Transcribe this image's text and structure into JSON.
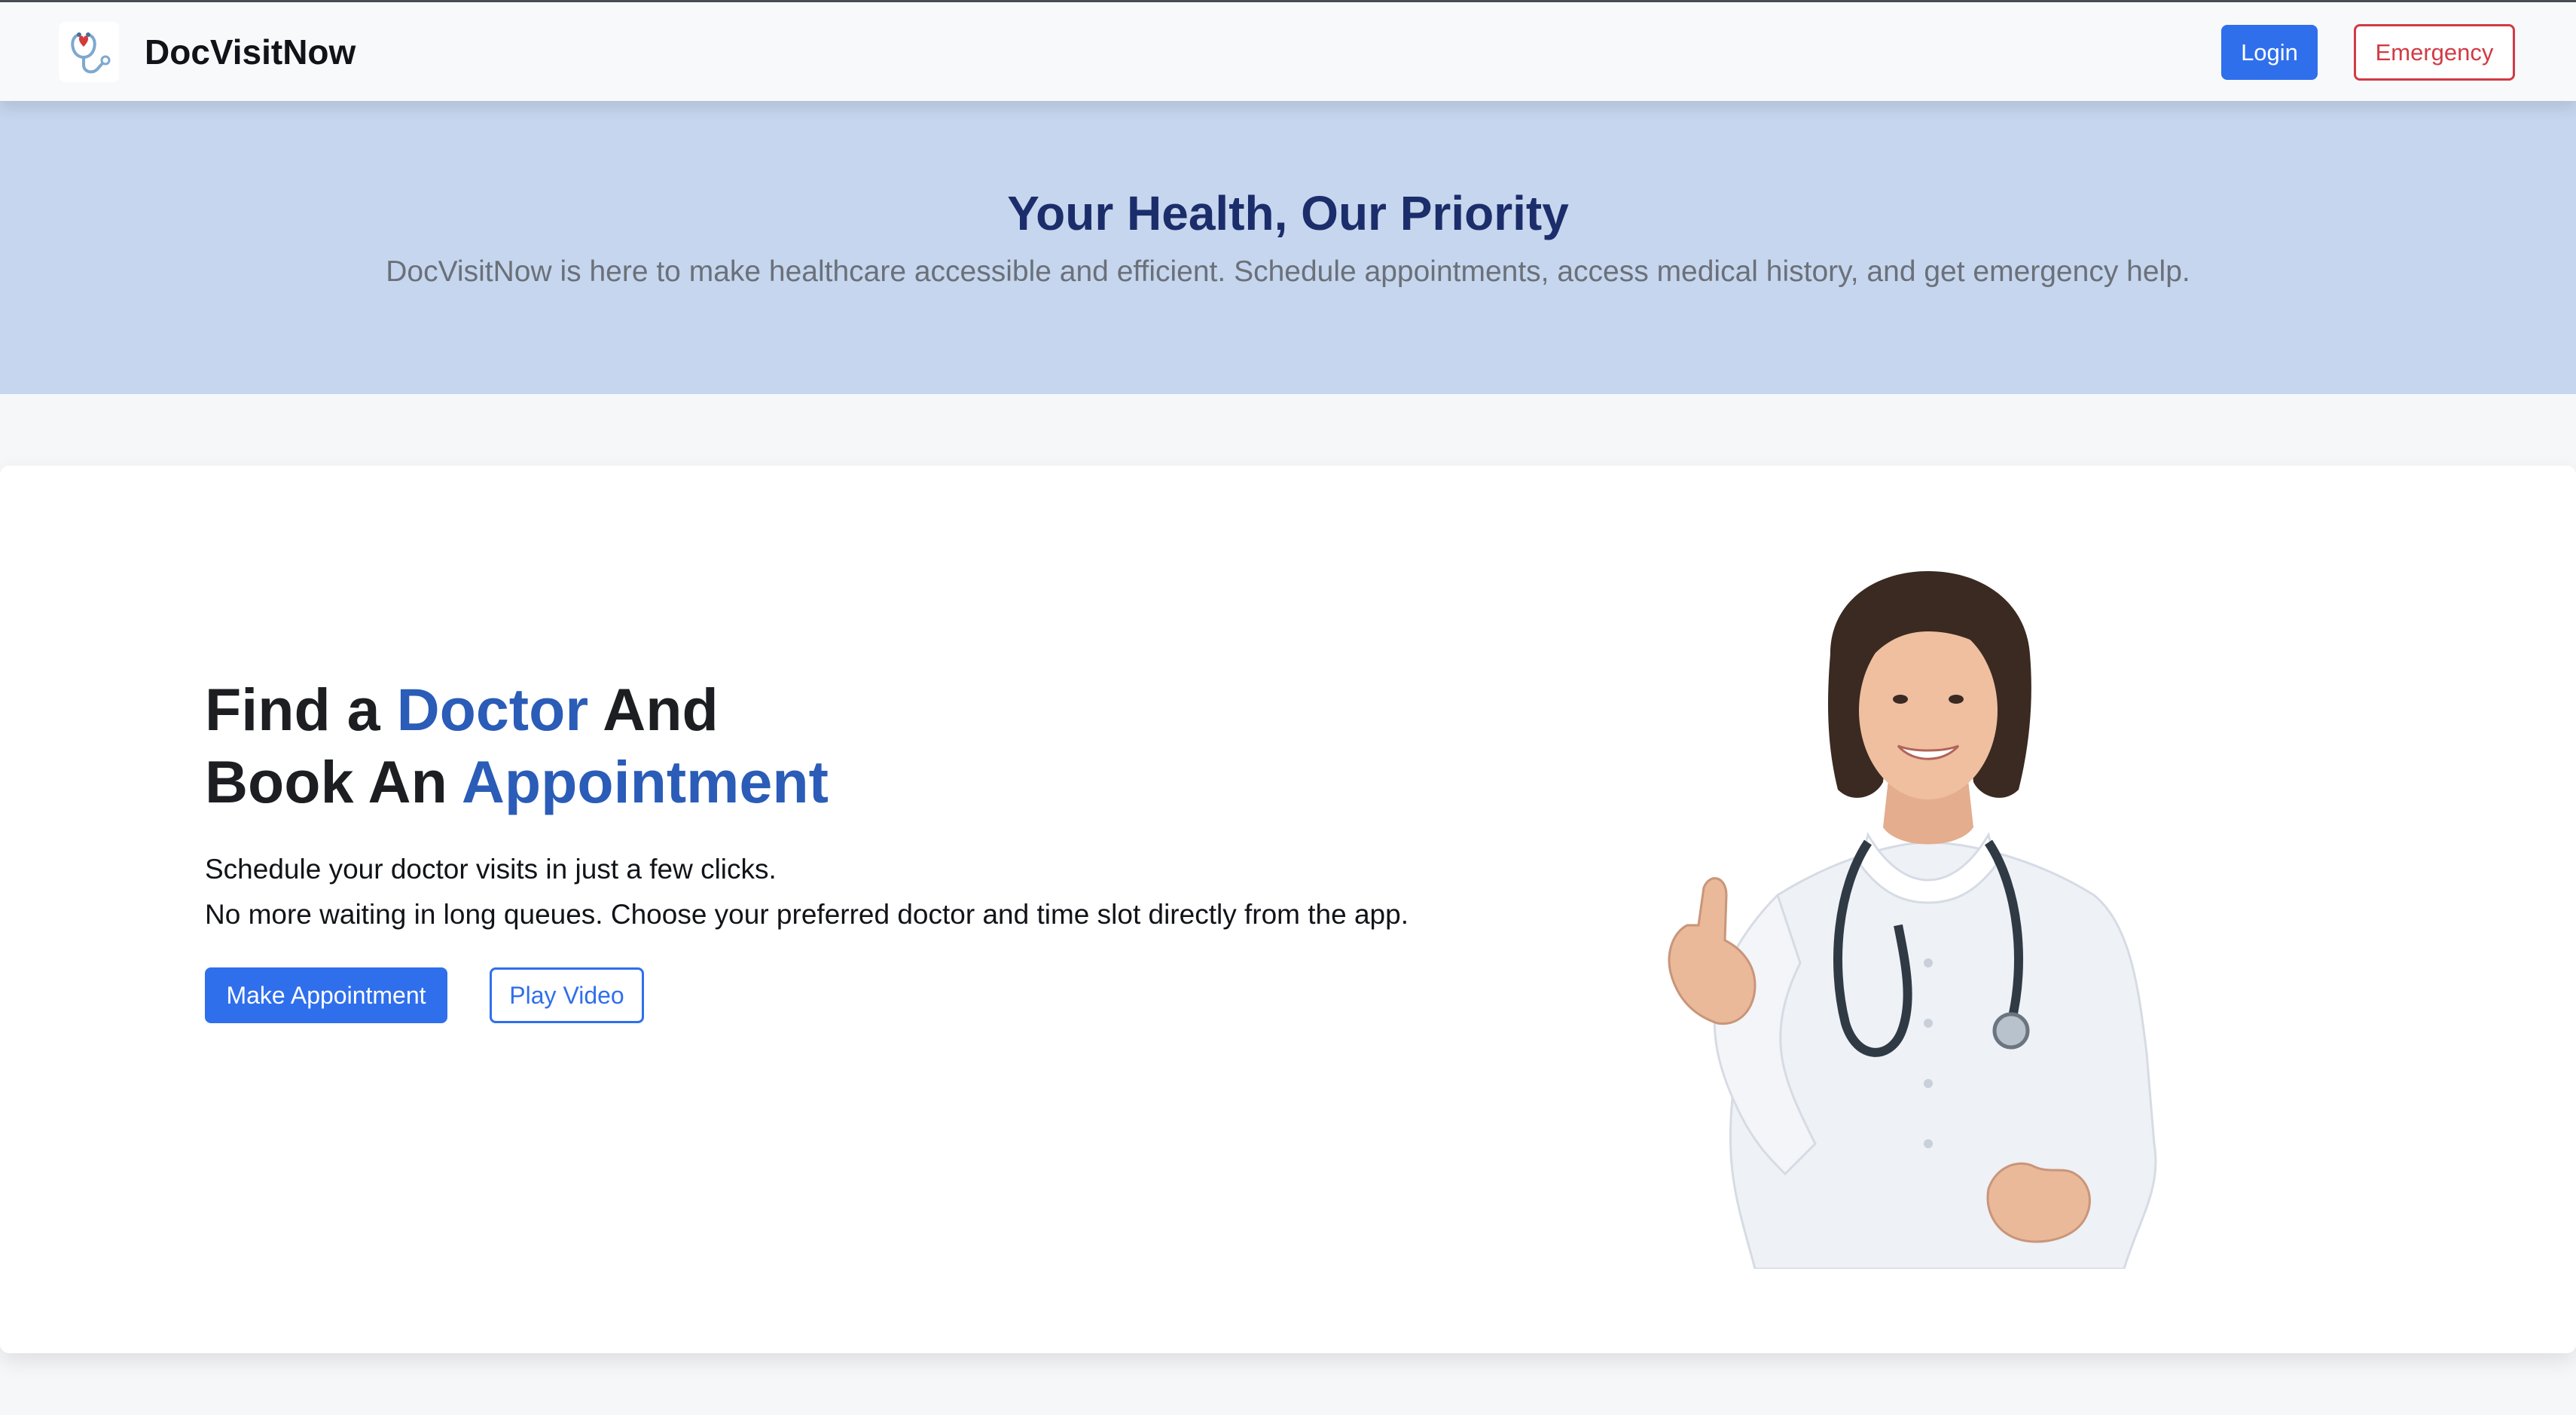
{
  "app": {
    "title": "DocVisitNow",
    "logo_icon": "stethoscope-heart-icon"
  },
  "nav": {
    "login_label": "Login",
    "emergency_label": "Emergency"
  },
  "hero": {
    "title": "Your Health, Our Priority",
    "subtitle": "DocVisitNow is here to make healthcare accessible and efficient. Schedule appointments, access medical history, and get emergency help."
  },
  "feature": {
    "headline_part1": "Find a ",
    "headline_highlight1": "Doctor",
    "headline_part2": " And",
    "headline_part3": "Book An ",
    "headline_highlight2": "Appointment",
    "desc_line1": "Schedule your doctor visits in just a few clicks.",
    "desc_line2": "No more waiting in long queues. Choose your preferred doctor and time slot directly from the app.",
    "make_appointment_label": "Make Appointment",
    "play_video_label": "Play Video"
  },
  "colors": {
    "primary": "#2f6fec",
    "danger": "#d13b45",
    "hero_bg": "#c5d6ee",
    "hero_title": "#1c2d6b",
    "highlight": "#2a5cb8"
  }
}
